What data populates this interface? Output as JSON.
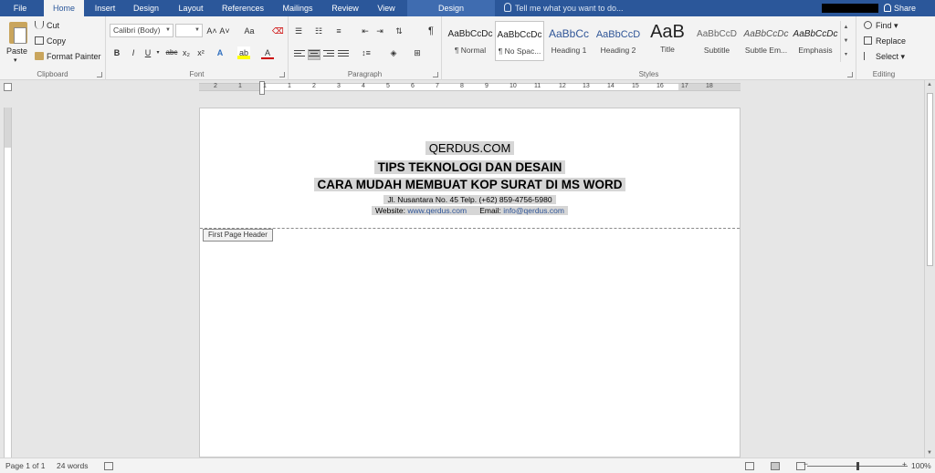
{
  "tabs": [
    {
      "label": "File",
      "active": false
    },
    {
      "label": "Home",
      "active": true
    },
    {
      "label": "Insert",
      "active": false
    },
    {
      "label": "Design",
      "active": false
    },
    {
      "label": "Layout",
      "active": false
    },
    {
      "label": "References",
      "active": false
    },
    {
      "label": "Mailings",
      "active": false
    },
    {
      "label": "Review",
      "active": false
    },
    {
      "label": "View",
      "active": false
    }
  ],
  "context_tab": "Design",
  "tell_me": "Tell me what you want to do...",
  "share": "Share",
  "clipboard": {
    "paste": "Paste",
    "cut": "Cut",
    "copy": "Copy",
    "format_painter": "Format Painter",
    "label": "Clipboard"
  },
  "font": {
    "name": "Calibri (Body)",
    "size": "",
    "grow": "A˄",
    "shrink": "A˅",
    "case": "Aa",
    "bold": "B",
    "italic": "I",
    "underline": "U",
    "strike": "abc",
    "subscript": "x₂",
    "superscript": "x²",
    "font_color": "A",
    "label": "Font"
  },
  "paragraph": {
    "pilcrow": "¶",
    "label": "Paragraph"
  },
  "styles": {
    "items": [
      {
        "sample": "AaBbCcDc",
        "name": "¶ Normal"
      },
      {
        "sample": "AaBbCcDc",
        "name": "¶ No Spac..."
      },
      {
        "sample": "AaBbCc",
        "name": "Heading 1"
      },
      {
        "sample": "AaBbCcD",
        "name": "Heading 2"
      },
      {
        "sample": "AaB",
        "name": "Title"
      },
      {
        "sample": "AaBbCcD",
        "name": "Subtitle"
      },
      {
        "sample": "AaBbCcDc",
        "name": "Subtle Em..."
      },
      {
        "sample": "AaBbCcDc",
        "name": "Emphasis"
      }
    ],
    "label": "Styles"
  },
  "editing": {
    "find": "Find",
    "replace": "Replace",
    "select": "Select",
    "label": "Editing"
  },
  "ruler": {
    "numbers": [
      "2",
      "1",
      "1",
      "1",
      "2",
      "3",
      "4",
      "5",
      "6",
      "7",
      "8",
      "9",
      "10",
      "11",
      "12",
      "13",
      "14",
      "15",
      "16",
      "17",
      "18"
    ]
  },
  "document": {
    "line1": "QERDUS.COM",
    "line2": "TIPS TEKNOLOGI DAN DESAIN",
    "line3": "CARA MUDAH MEMBUAT KOP SURAT DI MS WORD",
    "address": "Jl. Nusantara No. 45 Telp. (+62) 859-4756-5980",
    "website_label": "Website: ",
    "website": "www.qerdus.com",
    "email_label": "Email: ",
    "email": "info@qerdus.com",
    "header_tag": "First Page Header"
  },
  "status": {
    "page": "Page 1 of 1",
    "words": "24 words",
    "zoom": "100%"
  }
}
